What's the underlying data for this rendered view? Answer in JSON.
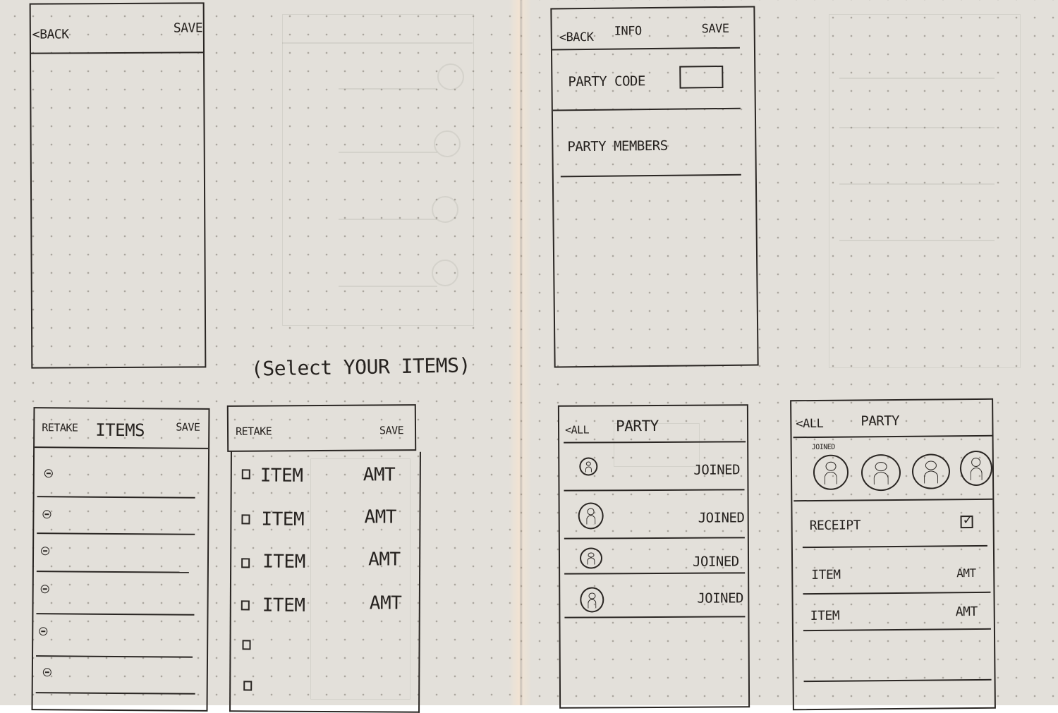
{
  "sketch1": {
    "back": "<BACK",
    "save": "SAVE"
  },
  "sketch2": {
    "back": "<BACK",
    "title": "INFO",
    "save": "SAVE",
    "party_code": "PARTY CODE",
    "party_members": "PARTY MEMBERS"
  },
  "caption": "(Select YOUR ITEMS)",
  "sketch3": {
    "retake": "RETAKE",
    "title": "ITEMS",
    "save": "SAVE",
    "row_count": 6
  },
  "sketch4": {
    "retake": "RETAKE",
    "save": "SAVE",
    "rows": [
      {
        "item": "ITEM",
        "amt": "AMT"
      },
      {
        "item": "ITEM",
        "amt": "AMT"
      },
      {
        "item": "ITEM",
        "amt": "AMT"
      },
      {
        "item": "ITEM",
        "amt": "AMT"
      }
    ]
  },
  "sketch5": {
    "back": "<ALL",
    "title": "PARTY",
    "members": [
      {
        "status": "JOINED"
      },
      {
        "status": "JOINED"
      },
      {
        "status": "JOINED"
      },
      {
        "status": "JOINED"
      }
    ]
  },
  "sketch6": {
    "back": "<ALL",
    "title": "PARTY",
    "joined_label": "JOINED",
    "receipt": "RECEIPT",
    "rows": [
      {
        "item": "ITEM",
        "amt": "AMT"
      },
      {
        "item": "ITEM",
        "amt": "AMT"
      }
    ]
  },
  "icons": {
    "checkbox": "checkbox-icon",
    "remove": "remove-circle-icon",
    "avatar": "person-avatar-icon",
    "checked": "checked-box-icon"
  }
}
